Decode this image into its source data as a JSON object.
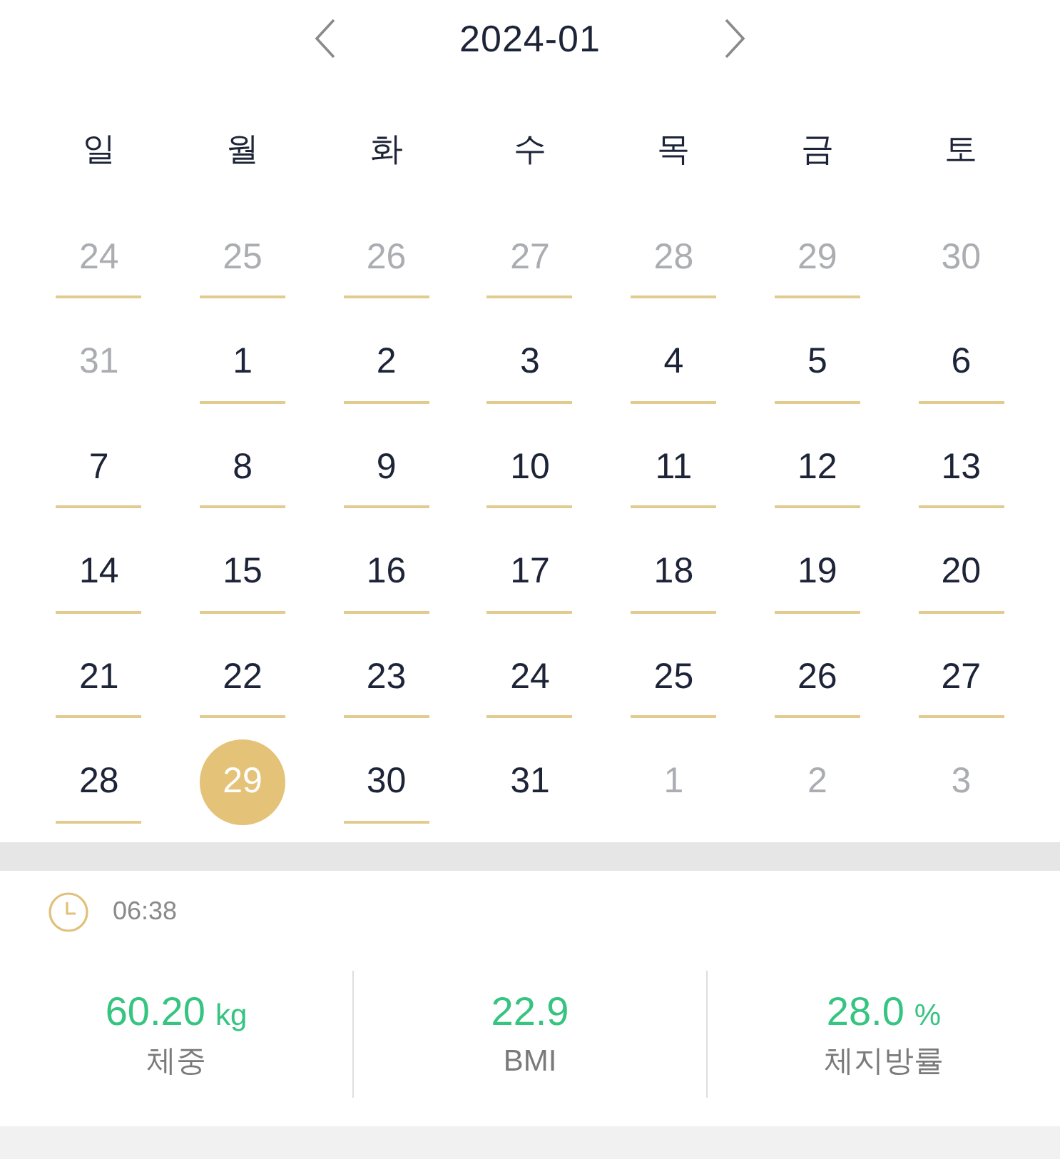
{
  "header": {
    "month": "2024-01"
  },
  "weekdays": [
    "일",
    "월",
    "화",
    "수",
    "목",
    "금",
    "토"
  ],
  "days": [
    {
      "label": "24",
      "outside": true,
      "recorded": true,
      "selected": false
    },
    {
      "label": "25",
      "outside": true,
      "recorded": true,
      "selected": false
    },
    {
      "label": "26",
      "outside": true,
      "recorded": true,
      "selected": false
    },
    {
      "label": "27",
      "outside": true,
      "recorded": true,
      "selected": false
    },
    {
      "label": "28",
      "outside": true,
      "recorded": true,
      "selected": false
    },
    {
      "label": "29",
      "outside": true,
      "recorded": true,
      "selected": false
    },
    {
      "label": "30",
      "outside": true,
      "recorded": false,
      "selected": false
    },
    {
      "label": "31",
      "outside": true,
      "recorded": false,
      "selected": false
    },
    {
      "label": "1",
      "outside": false,
      "recorded": true,
      "selected": false
    },
    {
      "label": "2",
      "outside": false,
      "recorded": true,
      "selected": false
    },
    {
      "label": "3",
      "outside": false,
      "recorded": true,
      "selected": false
    },
    {
      "label": "4",
      "outside": false,
      "recorded": true,
      "selected": false
    },
    {
      "label": "5",
      "outside": false,
      "recorded": true,
      "selected": false
    },
    {
      "label": "6",
      "outside": false,
      "recorded": true,
      "selected": false
    },
    {
      "label": "7",
      "outside": false,
      "recorded": true,
      "selected": false
    },
    {
      "label": "8",
      "outside": false,
      "recorded": true,
      "selected": false
    },
    {
      "label": "9",
      "outside": false,
      "recorded": true,
      "selected": false
    },
    {
      "label": "10",
      "outside": false,
      "recorded": true,
      "selected": false
    },
    {
      "label": "11",
      "outside": false,
      "recorded": true,
      "selected": false
    },
    {
      "label": "12",
      "outside": false,
      "recorded": true,
      "selected": false
    },
    {
      "label": "13",
      "outside": false,
      "recorded": true,
      "selected": false
    },
    {
      "label": "14",
      "outside": false,
      "recorded": true,
      "selected": false
    },
    {
      "label": "15",
      "outside": false,
      "recorded": true,
      "selected": false
    },
    {
      "label": "16",
      "outside": false,
      "recorded": true,
      "selected": false
    },
    {
      "label": "17",
      "outside": false,
      "recorded": true,
      "selected": false
    },
    {
      "label": "18",
      "outside": false,
      "recorded": true,
      "selected": false
    },
    {
      "label": "19",
      "outside": false,
      "recorded": true,
      "selected": false
    },
    {
      "label": "20",
      "outside": false,
      "recorded": true,
      "selected": false
    },
    {
      "label": "21",
      "outside": false,
      "recorded": true,
      "selected": false
    },
    {
      "label": "22",
      "outside": false,
      "recorded": true,
      "selected": false
    },
    {
      "label": "23",
      "outside": false,
      "recorded": true,
      "selected": false
    },
    {
      "label": "24",
      "outside": false,
      "recorded": true,
      "selected": false
    },
    {
      "label": "25",
      "outside": false,
      "recorded": true,
      "selected": false
    },
    {
      "label": "26",
      "outside": false,
      "recorded": true,
      "selected": false
    },
    {
      "label": "27",
      "outside": false,
      "recorded": true,
      "selected": false
    },
    {
      "label": "28",
      "outside": false,
      "recorded": true,
      "selected": false
    },
    {
      "label": "29",
      "outside": false,
      "recorded": false,
      "selected": true
    },
    {
      "label": "30",
      "outside": false,
      "recorded": true,
      "selected": false
    },
    {
      "label": "31",
      "outside": false,
      "recorded": false,
      "selected": false
    },
    {
      "label": "1",
      "outside": true,
      "recorded": false,
      "selected": false
    },
    {
      "label": "2",
      "outside": true,
      "recorded": false,
      "selected": false
    },
    {
      "label": "3",
      "outside": true,
      "recorded": false,
      "selected": false
    }
  ],
  "record": {
    "time": "06:38",
    "metrics": [
      {
        "value": "60.20",
        "unit": "kg",
        "label": "체중"
      },
      {
        "value": "22.9",
        "label": "BMI"
      },
      {
        "value": "28.0",
        "unit": "%",
        "label": "체지방률"
      }
    ]
  }
}
